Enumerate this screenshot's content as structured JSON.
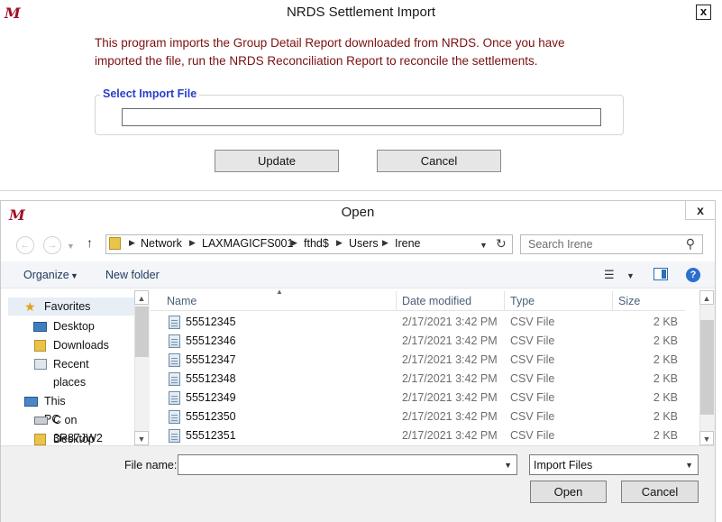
{
  "import_window": {
    "title": "NRDS Settlement Import",
    "logo": "M",
    "close": "x",
    "info_line1": "This program imports the Group Detail Report downloaded from NRDS. Once you have",
    "info_line2": "imported the file, run the NRDS Reconciliation Report to reconcile the settlements.",
    "group_label": "Select Import File",
    "update_label": "Update",
    "cancel_label": "Cancel"
  },
  "open_dialog": {
    "title": "Open",
    "logo": "M",
    "close": "x",
    "breadcrumb": [
      "Network",
      "LAXMAGICFS001",
      "fthd$",
      "Users",
      "Irene"
    ],
    "search_placeholder": "Search Irene",
    "organize_label": "Organize",
    "new_folder_label": "New folder",
    "nav": {
      "favorites": "Favorites",
      "desktop": "Desktop",
      "downloads": "Downloads",
      "recent": "Recent places",
      "this_pc": "This PC",
      "c_drive": "C on 3R87JW2",
      "desktop2": "Desktop"
    },
    "columns": {
      "name": "Name",
      "date": "Date modified",
      "type": "Type",
      "size": "Size"
    },
    "files": [
      {
        "name": "55512345",
        "date": "2/17/2021 3:42 PM",
        "type": "CSV File",
        "size": "2 KB"
      },
      {
        "name": "55512346",
        "date": "2/17/2021 3:42 PM",
        "type": "CSV File",
        "size": "2 KB"
      },
      {
        "name": "55512347",
        "date": "2/17/2021 3:42 PM",
        "type": "CSV File",
        "size": "2 KB"
      },
      {
        "name": "55512348",
        "date": "2/17/2021 3:42 PM",
        "type": "CSV File",
        "size": "2 KB"
      },
      {
        "name": "55512349",
        "date": "2/17/2021 3:42 PM",
        "type": "CSV File",
        "size": "2 KB"
      },
      {
        "name": "55512350",
        "date": "2/17/2021 3:42 PM",
        "type": "CSV File",
        "size": "2 KB"
      },
      {
        "name": "55512351",
        "date": "2/17/2021 3:42 PM",
        "type": "CSV File",
        "size": "2 KB"
      }
    ],
    "file_name_label": "File name:",
    "file_name_value": "",
    "filter_value": "Import Files",
    "open_label": "Open",
    "cancel_label": "Cancel"
  }
}
